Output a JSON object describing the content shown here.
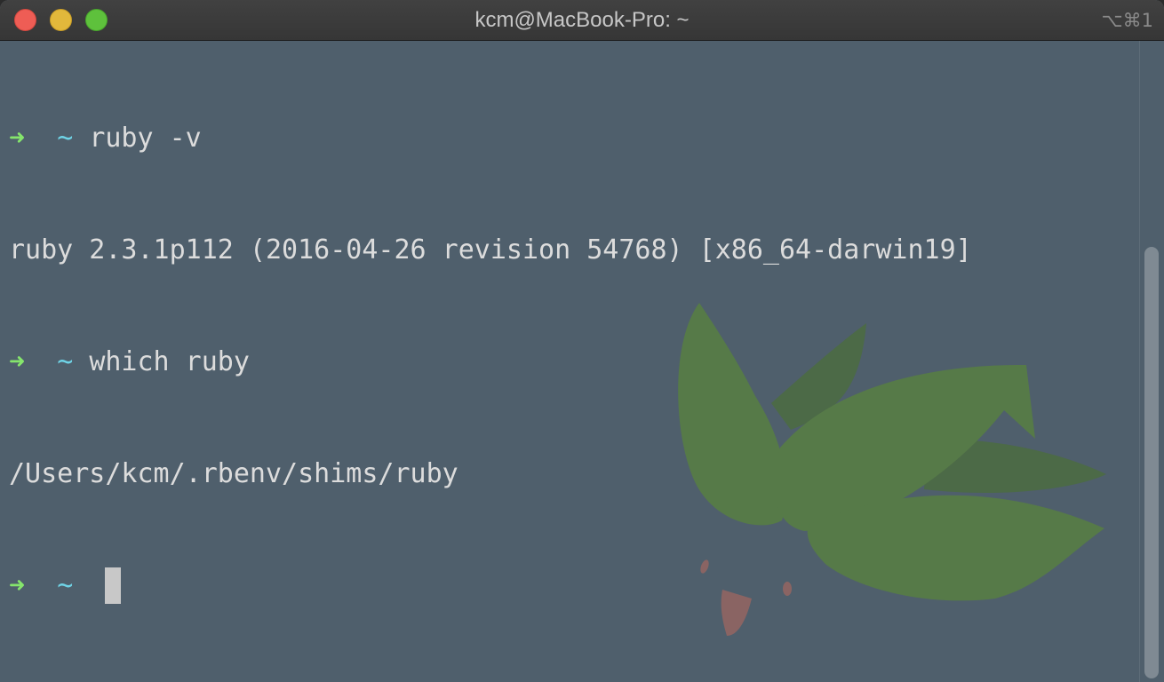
{
  "window": {
    "title": "kcm@MacBook-Pro: ~",
    "shortcut": "⌥⌘1",
    "background_color": "#4f5f6c"
  },
  "terminal": {
    "prompt_arrow": "➜",
    "prompt_dir": "~",
    "lines": [
      {
        "type": "prompt",
        "command": "ruby -v"
      },
      {
        "type": "output",
        "text": "ruby 2.3.1p112 (2016-04-26 revision 54768) [x86_64-darwin19]"
      },
      {
        "type": "prompt",
        "command": "which ruby"
      },
      {
        "type": "output",
        "text": "/Users/kcm/.rbenv/shims/ruby"
      },
      {
        "type": "prompt",
        "command": ""
      }
    ],
    "colors": {
      "arrow": "#85e56c",
      "tilde": "#6fd3e6",
      "text": "#dcdcdc"
    }
  },
  "icons": {
    "close": "close-button",
    "minimize": "minimize-button",
    "zoom": "zoom-button",
    "background_art": "leaf-background-art"
  }
}
